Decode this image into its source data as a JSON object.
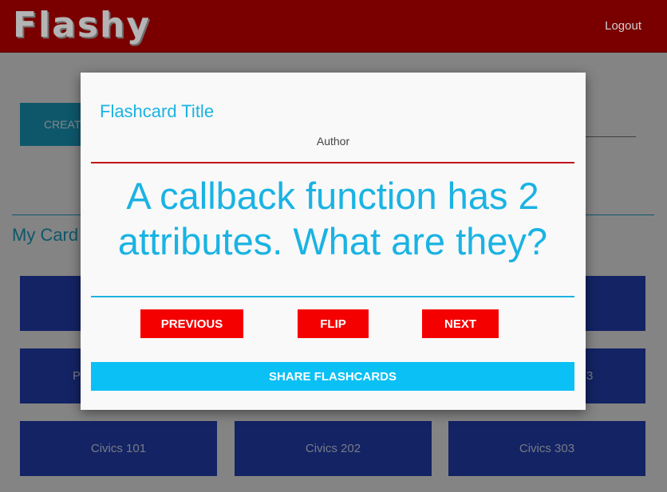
{
  "header": {
    "logo": "Flashy",
    "logout_label": "Logout"
  },
  "page": {
    "create_label": "CREAT",
    "my_cards_label": "My Card",
    "decks": [
      {
        "label": ""
      },
      {
        "label": ""
      },
      {
        "label": ""
      },
      {
        "label": "P"
      },
      {
        "label": ""
      },
      {
        "label": "3"
      },
      {
        "label": "Civics 101"
      },
      {
        "label": "Civics 202"
      },
      {
        "label": "Civics 303"
      }
    ]
  },
  "modal": {
    "title": "Flashcard Title",
    "author": "Author",
    "card_text": "A callback function has 2 attributes. What are they?",
    "previous_label": "PREVIOUS",
    "flip_label": "FLIP",
    "next_label": "NEXT",
    "share_label": "SHARE FLASHCARDS"
  },
  "colors": {
    "header_bg": "#7a0000",
    "accent_blue": "#1ab3e3",
    "deck_blue": "#2340b7",
    "button_red": "#f40000",
    "share_blue": "#0ac0f5"
  }
}
